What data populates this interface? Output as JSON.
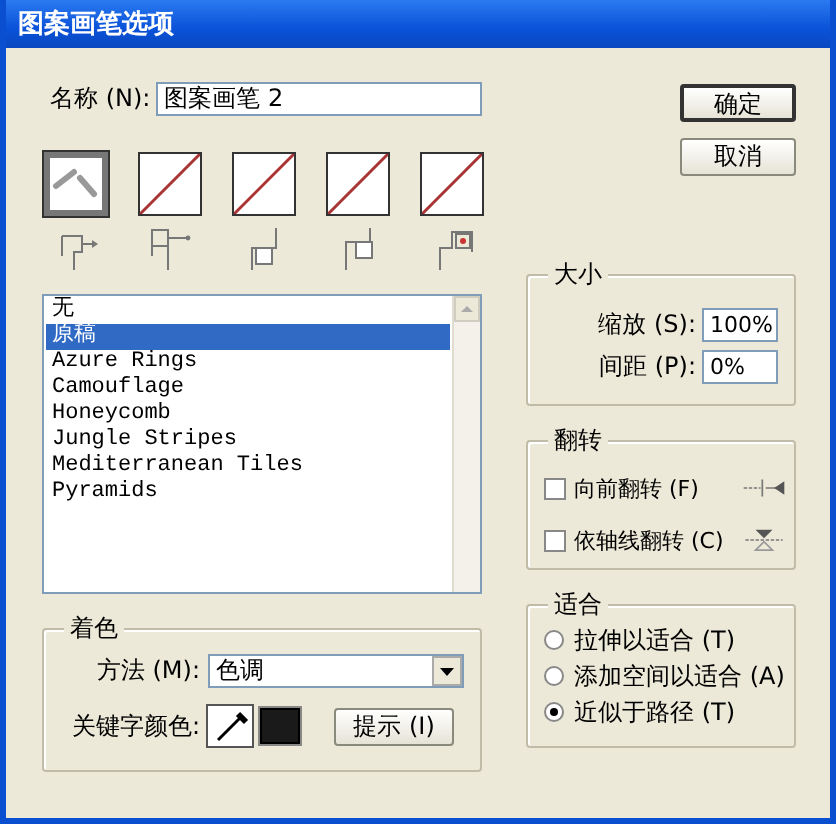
{
  "window": {
    "title": "图案画笔选项"
  },
  "name_field": {
    "label": "名称 (N):",
    "value": "图案画笔 2"
  },
  "buttons": [
    {
      "label": "确定",
      "default": true
    },
    {
      "label": "取消",
      "default": false
    }
  ],
  "tiles": [
    {
      "kind": "brush",
      "selected": true
    },
    {
      "kind": "empty",
      "selected": false
    },
    {
      "kind": "empty",
      "selected": false
    },
    {
      "kind": "empty",
      "selected": false
    },
    {
      "kind": "empty",
      "selected": false
    }
  ],
  "pattern_list": {
    "items": [
      {
        "label": "无",
        "selected": false
      },
      {
        "label": "原稿",
        "selected": true
      },
      {
        "label": "Azure Rings",
        "selected": false
      },
      {
        "label": "Camouflage",
        "selected": false
      },
      {
        "label": "Honeycomb",
        "selected": false
      },
      {
        "label": "Jungle Stripes",
        "selected": false
      },
      {
        "label": "Mediterranean Tiles",
        "selected": false
      },
      {
        "label": "Pyramids",
        "selected": false
      }
    ]
  },
  "size": {
    "title": "大小",
    "fields": [
      {
        "label": "缩放 (S):",
        "value": "100%"
      },
      {
        "label": "间距 (P):",
        "value": "0%"
      }
    ]
  },
  "flip": {
    "title": "翻转",
    "options": [
      {
        "label": "向前翻转 (F)",
        "checked": false,
        "kind": "along"
      },
      {
        "label": "依轴线翻转 (C)",
        "checked": false,
        "kind": "across"
      }
    ]
  },
  "colorization": {
    "title": "着色",
    "method": {
      "label": "方法 (M):",
      "value": "色调"
    },
    "key_color": {
      "label": "关键字颜色:",
      "color": "#1a1a1a"
    },
    "tips_button": "提示 (I)"
  },
  "fit": {
    "title": "适合",
    "options": [
      {
        "label": "拉伸以适合 (T)",
        "selected": false
      },
      {
        "label": "添加空间以适合 (A)",
        "selected": false
      },
      {
        "label": "近似于路径 (T)",
        "selected": true
      }
    ]
  }
}
